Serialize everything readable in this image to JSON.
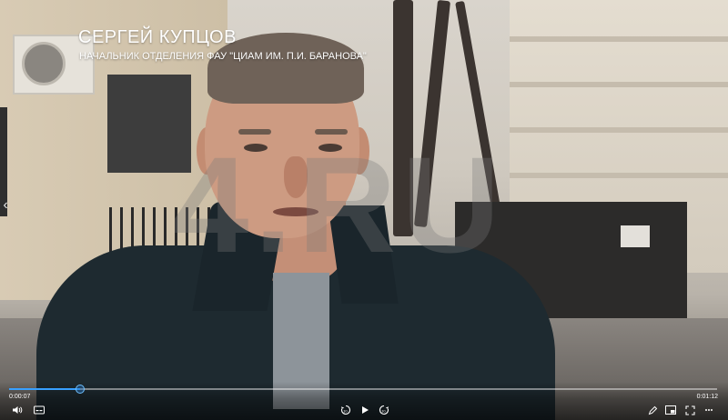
{
  "video": {
    "lower_third": {
      "name": "СЕРГЕЙ КУПЦОВ",
      "title": "НАЧАЛЬНИК ОТДЕЛЕНИЯ ФАУ \"ЦИАМ ИМ. П.И. БАРАНОВА\""
    },
    "watermark_text": "4.RU"
  },
  "player": {
    "time_elapsed": "0:00:07",
    "time_total": "0:01:12",
    "progress_fraction": 0.1,
    "accent_color": "#38a0ff",
    "icons": {
      "volume": "volume-icon",
      "captions": "captions-icon",
      "rewind": "rewind-10-icon",
      "play": "play-icon",
      "forward": "forward-10-icon",
      "edit": "pencil-icon",
      "pip": "picture-in-picture-icon",
      "fullscreen": "fullscreen-icon",
      "more": "more-icon",
      "prev": "chevron-left-icon"
    }
  }
}
